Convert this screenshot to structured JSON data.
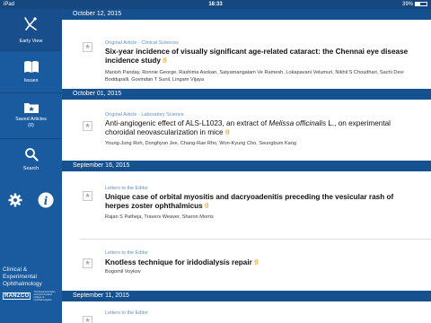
{
  "status_bar": {
    "carrier": "iPad",
    "time": "18:33",
    "battery_text": "39%",
    "battery_level": 0.39
  },
  "sidebar": {
    "items": [
      {
        "label": "Early View",
        "icon": "early-view-icon"
      },
      {
        "label": "Issues",
        "icon": "book-icon"
      },
      {
        "label": "Saved Articles\n(0)",
        "icon": "saved-folder-icon"
      },
      {
        "label": "Search",
        "icon": "search-icon"
      }
    ],
    "tools": {
      "settings_icon": "gear-icon",
      "info_icon": "info-icon"
    },
    "brand": {
      "line1": "Clinical & Experimental",
      "line2": "Ophthalmology"
    },
    "logo": {
      "mark": "RANZCO",
      "text_line1": "The Royal Australian",
      "text_line2": "and New Zealand",
      "text_line3": "College of Ophthalmologists"
    },
    "colors": {
      "background": "#1a5a9e",
      "active": "#174e8b"
    }
  },
  "feed": {
    "sections": [
      {
        "date": "October 12, 2015",
        "articles": [
          {
            "type": "Original Article - Clinical Sciences",
            "title": "Six-year incidence of visually significant age-related cataract: the Chennai eye disease incidence study",
            "authors": "Manish Panday, Ronnie George, Rashima Asokan, Satyamangalam Ve Ramesh, Lokapavani Velumuri, Nikhil S Choudhari, Sachi Devi Boddupalli, Govindan T Sunil, Lingam Vijaya",
            "open_access": true
          }
        ]
      },
      {
        "date": "October 01, 2015",
        "articles": [
          {
            "type": "Original Article - Laboratory Science",
            "title_part1": "Anti-angiogenic effect of ALS-L1023, an extract of ",
            "title_italic": "Melissa officinalis",
            "title_part2": " L., on experimental choroidal neovascularization in mice",
            "authors": "Young-Jung Roh, Donghyun Jee, Chang-Rae Rho, Won-Kyung Cho, Seungbum Kang",
            "open_access": true
          }
        ]
      },
      {
        "date": "September 16, 2015",
        "articles": [
          {
            "type": "Letters to the Editor",
            "title": "Unique case of orbital myositis and dacryoadenitis preceding the vesicular rash of herpes zoster ophthalmicus",
            "authors": "Rajan S Patheja, Travers Weaver, Sharon Morris",
            "open_access": true
          },
          {
            "type": "Letters to the Editor",
            "title": "Knotless technique for iridodialysis repair",
            "authors": "Bogomil Voykov",
            "open_access": true
          }
        ]
      },
      {
        "date": "September 11, 2015",
        "articles": [
          {
            "type": "Letters to the Editor"
          }
        ]
      }
    ],
    "star_glyph": "★",
    "oa_glyph": "θ",
    "colors": {
      "date_header": "#16518f",
      "article_type": "#5f8fc3",
      "open_access": "#f39a2a"
    }
  }
}
